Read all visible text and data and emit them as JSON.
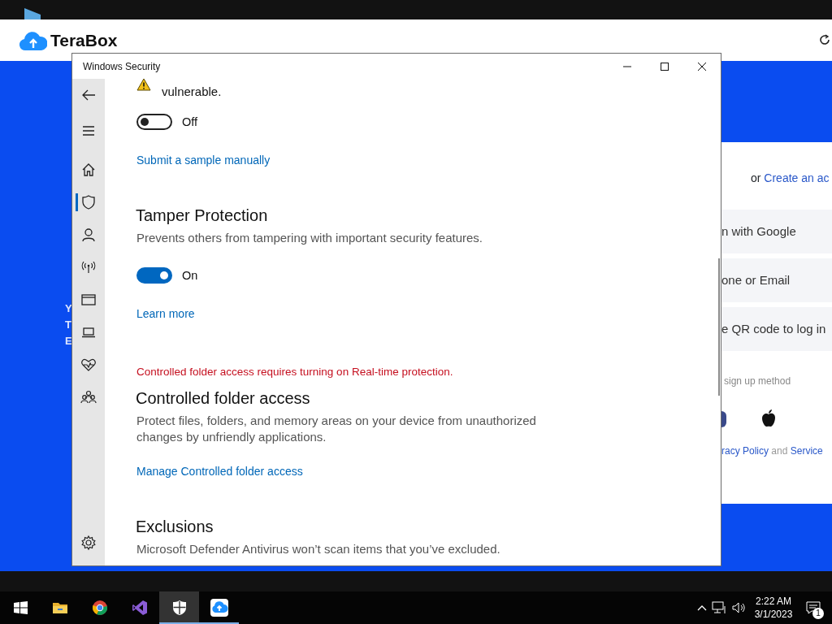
{
  "browser": {
    "logo": "TeraBox",
    "left_fragments": [
      "Y",
      "T",
      "E"
    ],
    "create_prefix": "or",
    "create_link": "Create an ac",
    "options": [
      "n with Google",
      "one or Email",
      "e QR code to log in"
    ],
    "signup_hint": "sign up method",
    "policy_link": "racy Policy",
    "policy_and": "and",
    "service_link": "Service"
  },
  "window": {
    "title": "Windows Security"
  },
  "sidebar": {
    "items": [
      {
        "kind": "back",
        "selected": false
      },
      {
        "kind": "menu",
        "selected": false
      },
      {
        "kind": "home",
        "selected": false
      },
      {
        "kind": "shield",
        "selected": true
      },
      {
        "kind": "person",
        "selected": false
      },
      {
        "kind": "antenna",
        "selected": false
      },
      {
        "kind": "browser",
        "selected": false
      },
      {
        "kind": "laptop",
        "selected": false
      },
      {
        "kind": "heart",
        "selected": false
      },
      {
        "kind": "family",
        "selected": false
      },
      {
        "kind": "settings",
        "selected": false
      }
    ]
  },
  "content": [
    {
      "kind": "warning",
      "text": "vulnerable."
    },
    {
      "kind": "toggle",
      "on": false,
      "label": "Off"
    },
    {
      "kind": "link",
      "text": "Submit a sample manually"
    },
    {
      "kind": "heading",
      "text": "Tamper Protection"
    },
    {
      "kind": "text",
      "text": "Prevents others from tampering with important security features."
    },
    {
      "kind": "toggle",
      "on": true,
      "label": "On"
    },
    {
      "kind": "link",
      "text": "Learn more"
    },
    {
      "kind": "error",
      "text": "Controlled folder access requires turning on Real-time protection."
    },
    {
      "kind": "heading",
      "text": "Controlled folder access"
    },
    {
      "kind": "text",
      "text": "Protect files, folders, and memory areas on your device from unauthorized changes by unfriendly applications."
    },
    {
      "kind": "link",
      "text": "Manage Controlled folder access"
    },
    {
      "kind": "heading",
      "text": "Exclusions"
    },
    {
      "kind": "text",
      "text": "Microsoft Defender Antivirus won’t scan items that you’ve excluded."
    }
  ],
  "taskbar": {
    "apps": [
      {
        "kind": "start",
        "selected": false,
        "running": false
      },
      {
        "kind": "explorer",
        "selected": false,
        "running": false
      },
      {
        "kind": "chrome",
        "selected": false,
        "running": false
      },
      {
        "kind": "studio",
        "selected": false,
        "running": false
      },
      {
        "kind": "security",
        "selected": true,
        "running": true
      },
      {
        "kind": "terabox",
        "selected": false,
        "running": true
      }
    ],
    "time": "2:22 AM",
    "date": "3/1/2023",
    "notifications": "1"
  }
}
